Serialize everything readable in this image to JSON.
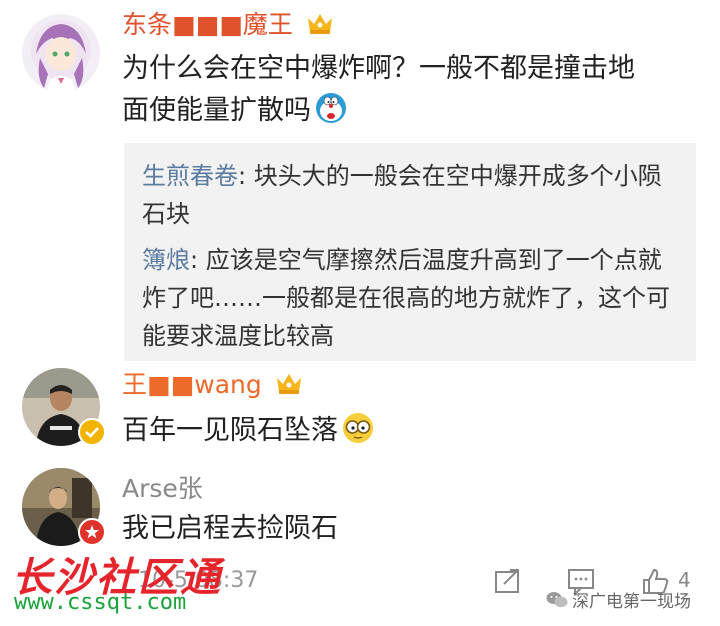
{
  "comments": [
    {
      "author": "东条■■■魔王",
      "text": "为什么会在空中爆炸啊？一般不都是撞击地面使能量扩散吗",
      "text_line1": "为什么会在空中爆炸啊？一般不都是撞击地",
      "text_line2": "面使能量扩散吗",
      "replies": [
        {
          "author": "生煎春卷",
          "sep": ": ",
          "text": "块头大的一般会在空中爆开成多个小陨石块"
        },
        {
          "author": "簿烺",
          "sep": ": ",
          "text": "应该是空气摩擦然后温度升高到了一个点就炸了吧……一般都是在很高的地方就炸了，这个可能要求温度比较高"
        }
      ]
    },
    {
      "author": "王■■wang",
      "text": "百年一见陨石坠落"
    },
    {
      "author": "Arse张",
      "text": "我已启程去捡陨石"
    }
  ],
  "footer": {
    "time": "10-5 08:37",
    "like_count": "4"
  },
  "watermarks": {
    "brand": "长沙社区通",
    "url": "www.cssqt.com",
    "wechat": "深广电第一现场"
  },
  "colors": {
    "author_red": "#e0522b",
    "author_orange": "#ec6b2a",
    "author_gray": "#888888",
    "reply_author": "#5b7ba1",
    "watermark_red": "#e5242c",
    "watermark_green": "#1aa33a"
  }
}
